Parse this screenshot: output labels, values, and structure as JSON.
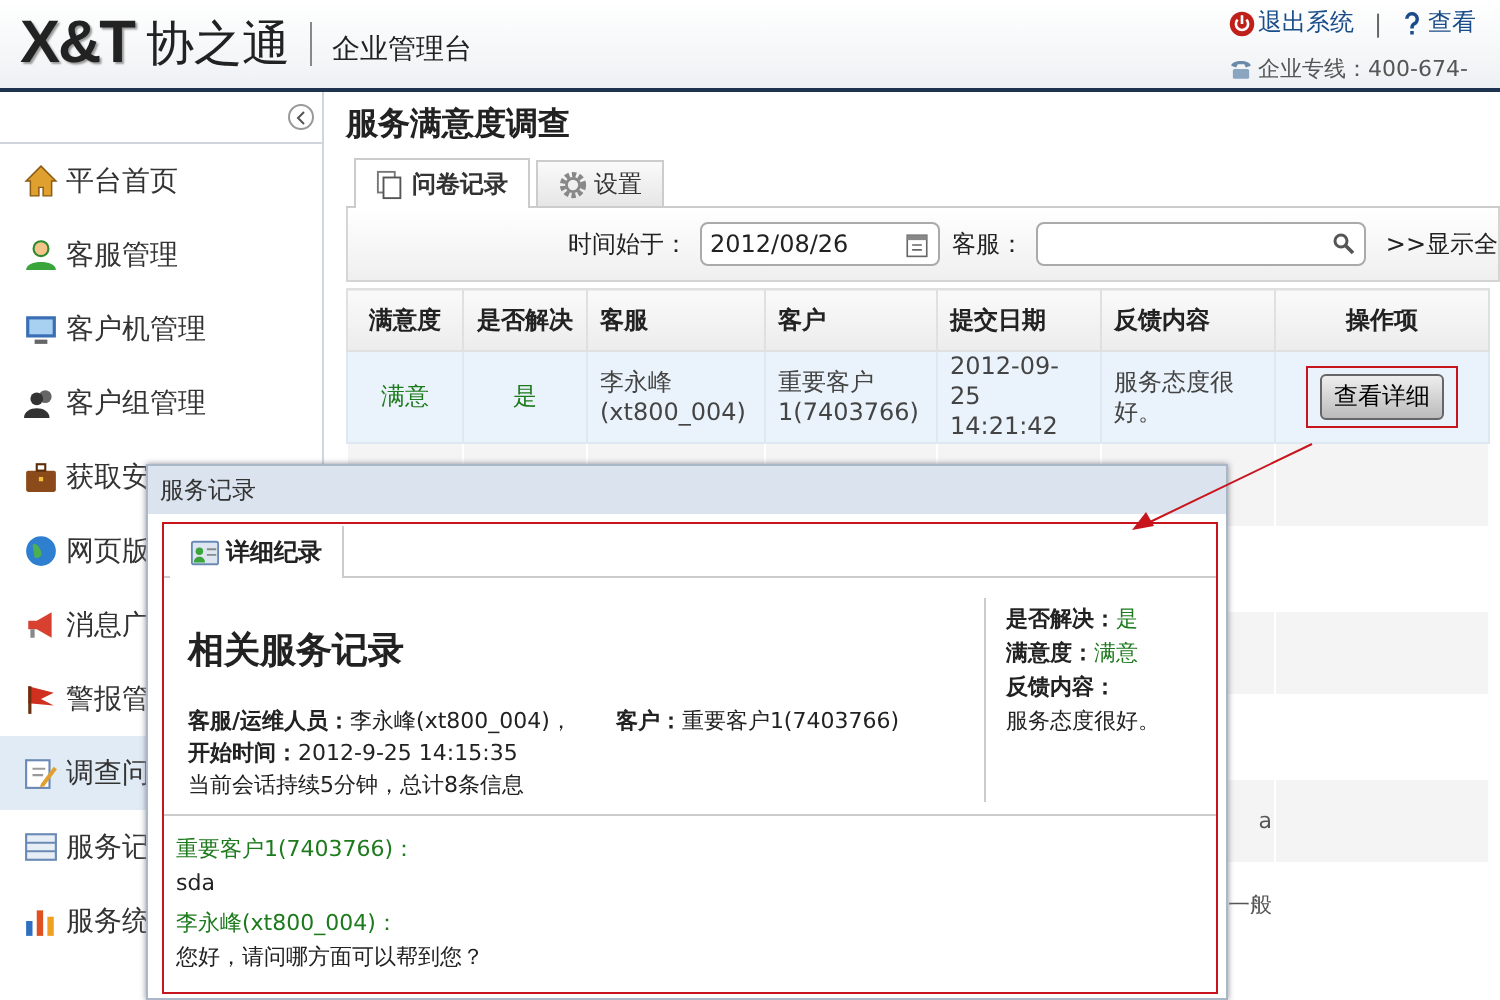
{
  "header": {
    "logo_mark": "X&T",
    "logo_name": "协之通",
    "subtitle": "企业管理台",
    "links": [
      {
        "label": "退出系统"
      },
      {
        "label": "查看"
      }
    ],
    "separator": "|",
    "hotline": "企业专线：400-674-"
  },
  "sidebar": {
    "items": [
      {
        "label": "平台首页",
        "selected": false
      },
      {
        "label": "客服管理",
        "selected": false
      },
      {
        "label": "客户机管理",
        "selected": false
      },
      {
        "label": "客户组管理",
        "selected": false
      },
      {
        "label": "获取安",
        "selected": false
      },
      {
        "label": "网页版",
        "selected": false
      },
      {
        "label": "消息广",
        "selected": false
      },
      {
        "label": "警报管",
        "selected": false
      },
      {
        "label": "调查问",
        "selected": true
      },
      {
        "label": "服务记",
        "selected": false
      },
      {
        "label": "服务统",
        "selected": false
      }
    ]
  },
  "page_title": "服务满意度调查",
  "tabs": [
    {
      "label": "问卷记录",
      "selected": true
    },
    {
      "label": "设置",
      "selected": false
    }
  ],
  "filter": {
    "date_label": "时间始于：",
    "date_value": "2012/08/26",
    "agent_label": "客服：",
    "show_all": ">>显示全"
  },
  "table": {
    "columns": [
      "满意度",
      "是否解决",
      "客服",
      "客户",
      "提交日期",
      "反馈内容",
      "操作项"
    ],
    "rows": [
      {
        "kind": "full",
        "satisfaction": "满意",
        "resolved": "是",
        "agent": "李永峰(xt800_004)",
        "customer": "重要客户1(7403766)",
        "date": "2012-09-25 14:21:42",
        "feedback": "服务态度很好。",
        "action": "查看详细"
      },
      {
        "kind": "hidden"
      },
      {
        "kind": "hidden"
      },
      {
        "kind": "hidden"
      },
      {
        "kind": "hidden"
      },
      {
        "kind": "hidden",
        "feedback": "a"
      },
      {
        "kind": "hidden",
        "feedback": "一般"
      }
    ]
  },
  "dialog": {
    "title": "服务记录",
    "tab": "详细纪录",
    "heading": "相关服务记录",
    "agent_line": "**客服/运维人员：**李永峰(xt800_004)，",
    "customer_line": "**客户：**重要客户1(7403766)",
    "start_line": "**开始时间：**2012-9-25 14:15:35",
    "summary": "当前会话持续5分钟，总计8条信息",
    "status": [
      {
        "label": "是否解决：",
        "value": "是"
      },
      {
        "label": "满意度：",
        "value": "满意"
      },
      {
        "label": "反馈内容："
      }
    ],
    "feedback": "服务态度很好。",
    "messages": [
      {
        "sender": "重要客户1(7403766)：",
        "text": "sda"
      },
      {
        "sender": "李永峰(xt800_004)：",
        "text": "您好，请问哪方面可以帮到您？"
      }
    ]
  }
}
